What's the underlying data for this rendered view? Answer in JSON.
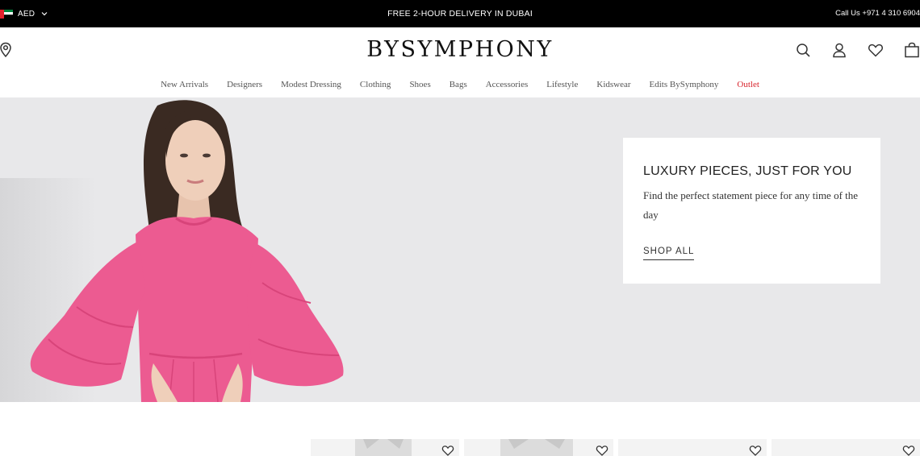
{
  "topbar": {
    "currency": "AED",
    "currency_icon": "chevron-down-icon",
    "flag": "uae-flag",
    "promo": "FREE 2-HOUR DELIVERY IN DUBAI",
    "call": "Call Us +971 4 310 6904"
  },
  "header": {
    "logo": "BYSYMPHONY",
    "icons": [
      "location-icon",
      "search-icon",
      "account-icon",
      "wishlist-icon",
      "bag-icon"
    ]
  },
  "nav": {
    "items": [
      "New Arrivals",
      "Designers",
      "Modest Dressing",
      "Clothing",
      "Shoes",
      "Bags",
      "Accessories",
      "Lifestyle",
      "Kidswear",
      "Edits BySymphony",
      "Outlet"
    ],
    "highlight_color": "#d8252e"
  },
  "hero": {
    "title": "LUXURY PIECES, JUST FOR YOU",
    "subtitle": "Find the perfect statement piece for any time of the day",
    "cta": "SHOP ALL",
    "dress_color": "#ec5b91",
    "background": "#e8e8ea"
  },
  "products": {
    "icon": "heart-icon",
    "count": 4
  }
}
